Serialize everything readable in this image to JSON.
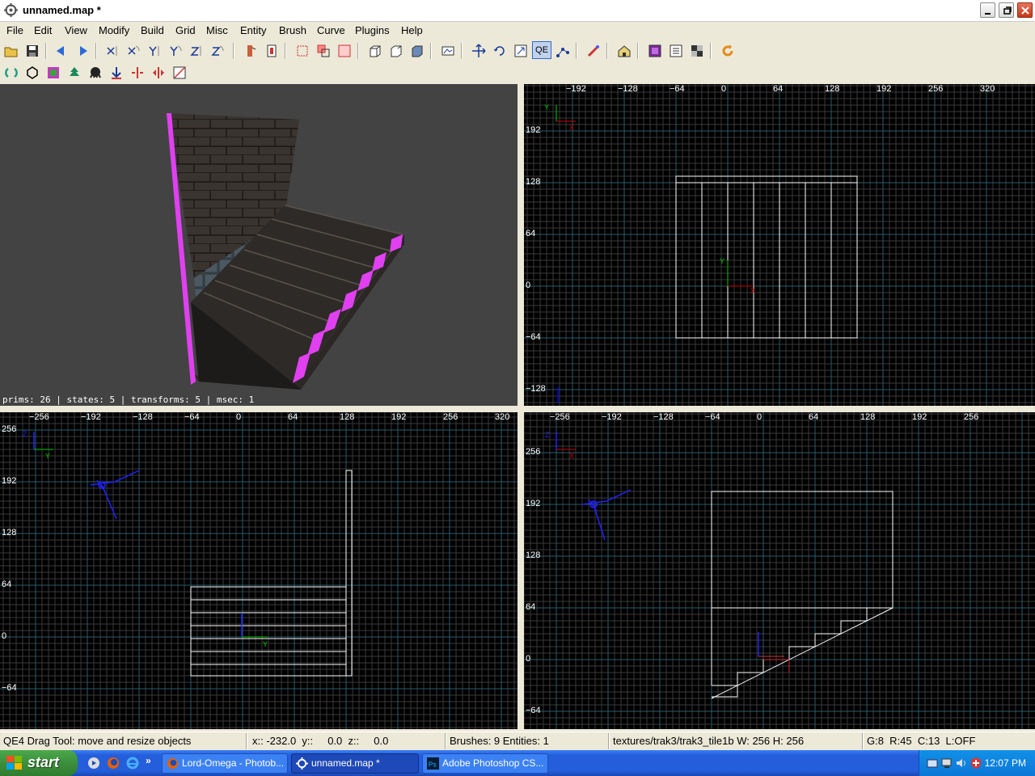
{
  "window": {
    "title": "unnamed.map *"
  },
  "menu": [
    "File",
    "Edit",
    "View",
    "Modify",
    "Build",
    "Grid",
    "Misc",
    "Entity",
    "Brush",
    "Curve",
    "Plugins",
    "Help"
  ],
  "toolbar": {
    "qe_label": "QE"
  },
  "views": {
    "camera": {
      "stats": "prims: 26 | states: 5 | transforms: 5 | msec: 1"
    },
    "xy": {
      "top_labels": [
        "-192",
        "-128",
        "-64",
        "0",
        "64",
        "128",
        "192",
        "256",
        "320"
      ],
      "side_labels": [
        "192",
        "128",
        "64",
        "0",
        "-64",
        "-128"
      ],
      "axis_v": "Y",
      "axis_h": "X"
    },
    "xz": {
      "top_labels": [
        "-256",
        "-192",
        "-128",
        "-64",
        "0",
        "64",
        "128",
        "192",
        "256",
        "320"
      ],
      "side_labels": [
        "256",
        "192",
        "128",
        "64",
        "0",
        "-64"
      ],
      "axis_v": "Z",
      "axis_h": "Y"
    },
    "yz": {
      "top_labels": [
        "-256",
        "-192",
        "-128",
        "-64",
        "0",
        "64",
        "128",
        "192",
        "256"
      ],
      "side_labels": [
        "256",
        "192",
        "128",
        "64",
        "0",
        "-64"
      ],
      "axis_v": "Z",
      "axis_h": "X"
    }
  },
  "status": {
    "hint": "QE4 Drag Tool: move and resize objects",
    "coords": "x:: -232.0  y::     0.0  z::     0.0",
    "counts": "Brushes: 9 Entities: 1",
    "texture": "textures/trak3/trak3_tile1b W: 256 H: 256",
    "grid": "G:8  R:45  C:13  L:OFF"
  },
  "taskbar": {
    "start_label": "start",
    "tasks": [
      "Lord-Omega - Photob...",
      "unnamed.map *",
      "Adobe Photoshop CS..."
    ],
    "clock": "12:07 PM"
  },
  "colors": {
    "grid_major": "#2a5c6a",
    "grid_minor": "#3a3a3a",
    "brush": "#ffffff",
    "highlight": "#ff00ff"
  }
}
